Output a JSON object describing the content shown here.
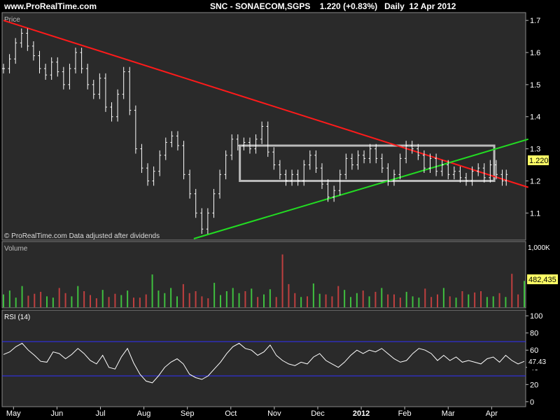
{
  "header": {
    "site": "www.ProRealTime.com",
    "symbol": "SNC - SONAECOM,SGPS",
    "last": "1.220",
    "change": "(+0.83%)",
    "period": "Daily",
    "date": "12 Apr 2012"
  },
  "panels": {
    "price": {
      "title": "Price",
      "footer": "© ProRealTime.com  Data adjusted after dividends",
      "last_label": "1.220"
    },
    "volume": {
      "title": "Volume",
      "scale_label": "1,000K",
      "last_label": "482,435"
    },
    "rsi": {
      "title": "RSI (14)",
      "last_label": "47.43"
    }
  },
  "colors": {
    "background": "#000000",
    "panel": "#2a2a2a",
    "candles": "#ffffff",
    "resistance": "#ff1a1a",
    "support": "#22dd22",
    "rectangle": "#bbbbbb",
    "volume_up": "#3fbf3f",
    "volume_down": "#bf3f3f",
    "rsi_line": "#ffffff",
    "rsi_bands": "#3030ff"
  },
  "chart_data": [
    {
      "type": "line",
      "title": "Price",
      "xlabels": [
        "May",
        "Jun",
        "Jul",
        "Aug",
        "Sep",
        "Oct",
        "Nov",
        "Dec",
        "2012",
        "Feb",
        "Mar",
        "Apr"
      ],
      "ylim": [
        1.02,
        1.72
      ],
      "yticks": [
        1.1,
        1.2,
        1.3,
        1.4,
        1.5,
        1.6,
        1.7
      ],
      "series": [
        {
          "name": "",
          "x": [
            0,
            3,
            6,
            9,
            12,
            15,
            18,
            21,
            24,
            27,
            30,
            33,
            36,
            39,
            42,
            45,
            48,
            51,
            54,
            57,
            60,
            63,
            66,
            69,
            72,
            75,
            78,
            81,
            84,
            87,
            90,
            93,
            96,
            99,
            102,
            105,
            108,
            111,
            114,
            117,
            120,
            123,
            126,
            129,
            132,
            135,
            138,
            141,
            144,
            147,
            150,
            153,
            156,
            159,
            162,
            165,
            168,
            171,
            174,
            177,
            180,
            183,
            186,
            189,
            192,
            195,
            198,
            201,
            204,
            207,
            210,
            213,
            216,
            219,
            222,
            225,
            228,
            231,
            234,
            237,
            240,
            243,
            246,
            249,
            251
          ],
          "values": [
            1.55,
            1.58,
            1.63,
            1.66,
            1.62,
            1.59,
            1.55,
            1.53,
            1.57,
            1.54,
            1.5,
            1.55,
            1.6,
            1.55,
            1.5,
            1.47,
            1.52,
            1.43,
            1.4,
            1.47,
            1.54,
            1.42,
            1.3,
            1.24,
            1.2,
            1.23,
            1.28,
            1.32,
            1.34,
            1.31,
            1.22,
            1.16,
            1.1,
            1.05,
            1.1,
            1.16,
            1.22,
            1.28,
            1.33,
            1.31,
            1.32,
            1.3,
            1.33,
            1.37,
            1.29,
            1.25,
            1.22,
            1.2,
            1.22,
            1.2,
            1.25,
            1.28,
            1.24,
            1.19,
            1.15,
            1.17,
            1.22,
            1.27,
            1.25,
            1.28,
            1.27,
            1.3,
            1.27,
            1.24,
            1.2,
            1.22,
            1.27,
            1.31,
            1.3,
            1.28,
            1.24,
            1.27,
            1.23,
            1.25,
            1.22,
            1.23,
            1.21,
            1.2,
            1.23,
            1.24,
            1.21,
            1.25,
            1.22,
            1.2,
            1.22
          ]
        }
      ],
      "lines": [
        {
          "name": "",
          "x": [
            0,
            262
          ],
          "values": [
            1.7,
            1.18
          ]
        },
        {
          "name": "",
          "x": [
            95,
            262
          ],
          "values": [
            1.02,
            1.33
          ]
        }
      ],
      "box": {
        "x": [
          118,
          245
        ],
        "y": [
          1.2,
          1.31
        ]
      }
    },
    {
      "type": "bar",
      "title": "Volume",
      "ylim": [
        0,
        1000
      ],
      "values": [
        200,
        260,
        150,
        330,
        180,
        210,
        240,
        170,
        150,
        300,
        220,
        170,
        330,
        250,
        190,
        140,
        270,
        160,
        210,
        190,
        260,
        150,
        150,
        200,
        510,
        260,
        220,
        300,
        170,
        360,
        220,
        250,
        170,
        140,
        380,
        190,
        250,
        300,
        220,
        250,
        290,
        160,
        200,
        280,
        160,
        820,
        360,
        220,
        160,
        170,
        370,
        210,
        200,
        170,
        330,
        270,
        160,
        220,
        260,
        170,
        240,
        300,
        200,
        200,
        150,
        240,
        170,
        150,
        290,
        160,
        200,
        300,
        170,
        150,
        250,
        200,
        230,
        250,
        160,
        170,
        220,
        160,
        520,
        200,
        410
      ],
      "up": [
        1,
        1,
        1,
        1,
        0,
        0,
        0,
        1,
        1,
        0,
        0,
        1,
        1,
        0,
        0,
        0,
        1,
        0,
        0,
        1,
        1,
        0,
        0,
        0,
        1,
        1,
        1,
        1,
        1,
        0,
        0,
        0,
        0,
        0,
        1,
        1,
        1,
        1,
        1,
        0,
        1,
        0,
        1,
        1,
        0,
        0,
        0,
        0,
        1,
        0,
        1,
        1,
        0,
        0,
        0,
        1,
        1,
        1,
        0,
        1,
        0,
        1,
        0,
        0,
        0,
        1,
        1,
        1,
        0,
        0,
        0,
        1,
        0,
        1,
        0,
        1,
        0,
        0,
        1,
        1,
        0,
        1,
        0,
        0,
        1
      ]
    },
    {
      "type": "line",
      "title": "RSI (14)",
      "ylim": [
        -5,
        105
      ],
      "yticks": [
        0,
        20,
        40,
        60,
        80,
        100
      ],
      "bands": [
        30,
        70
      ],
      "series": [
        {
          "name": "",
          "values": [
            55,
            58,
            64,
            68,
            60,
            54,
            47,
            46,
            58,
            56,
            50,
            55,
            62,
            56,
            48,
            44,
            54,
            40,
            38,
            52,
            62,
            45,
            32,
            24,
            22,
            30,
            40,
            46,
            50,
            44,
            32,
            28,
            26,
            30,
            38,
            46,
            56,
            64,
            68,
            62,
            60,
            54,
            58,
            66,
            54,
            48,
            44,
            42,
            46,
            44,
            52,
            56,
            48,
            44,
            40,
            46,
            54,
            60,
            56,
            60,
            58,
            62,
            56,
            50,
            46,
            48,
            56,
            62,
            60,
            56,
            48,
            54,
            48,
            52,
            46,
            48,
            46,
            44,
            50,
            52,
            46,
            54,
            48,
            44,
            47
          ]
        }
      ]
    }
  ]
}
